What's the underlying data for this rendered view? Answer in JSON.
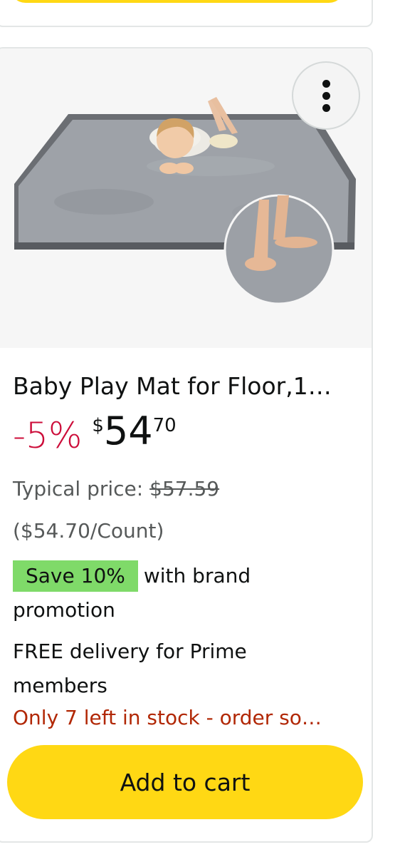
{
  "product": {
    "title": "Baby Play Mat for Floor,1…",
    "discount": "-5%",
    "price_symbol": "$",
    "price_whole": "54",
    "price_fraction": "70",
    "typical_label": "Typical price: ",
    "typical_value": "$57.59",
    "unit_price": "($54.70/Count)",
    "save_badge": "Save 10%",
    "promo_text": "with brand promotion",
    "delivery": "FREE delivery for Prime members",
    "stock": "Only 7 left in stock - order so…",
    "add_to_cart_label": "Add to cart"
  },
  "icons": {
    "more": "more-options-icon"
  },
  "colors": {
    "discount": "#cc0c39",
    "stock": "#b12704",
    "button": "#ffd814",
    "badge": "#7fda69"
  }
}
